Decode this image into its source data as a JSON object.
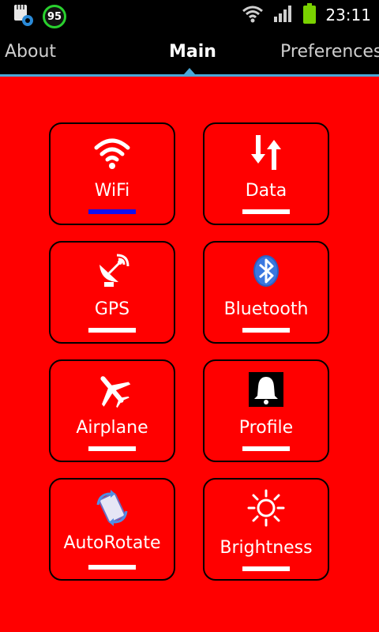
{
  "status_bar": {
    "battery_ring_value": "95",
    "time": "23:11"
  },
  "tabs": [
    {
      "label": "About"
    },
    {
      "label": "Main"
    },
    {
      "label": "Preferences"
    }
  ],
  "tiles": [
    {
      "label": "WiFi",
      "icon": "wifi-icon",
      "active": true
    },
    {
      "label": "Data",
      "icon": "data-arrows-icon",
      "active": false
    },
    {
      "label": "GPS",
      "icon": "satellite-dish-icon",
      "active": false
    },
    {
      "label": "Bluetooth",
      "icon": "bluetooth-icon",
      "active": false
    },
    {
      "label": "Airplane",
      "icon": "airplane-icon",
      "active": false
    },
    {
      "label": "Profile",
      "icon": "bell-icon",
      "active": false
    },
    {
      "label": "AutoRotate",
      "icon": "rotate-icon",
      "active": false
    },
    {
      "label": "Brightness",
      "icon": "sun-icon",
      "active": false
    }
  ],
  "colors": {
    "background": "#ff0000",
    "active_bar": "#1010ee",
    "inactive_bar": "#ffffff",
    "tab_accent": "#4aa8d8"
  }
}
